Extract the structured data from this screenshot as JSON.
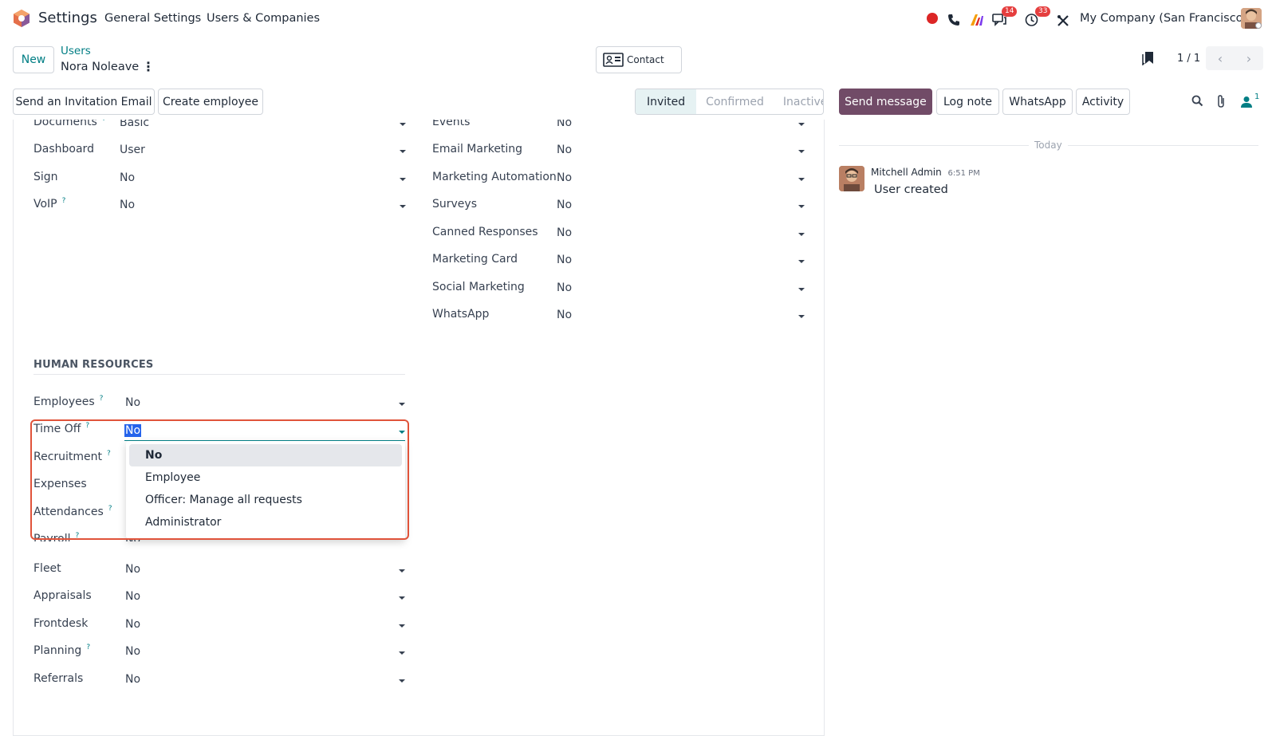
{
  "navbar": {
    "app_name": "Settings",
    "menus": [
      "General Settings",
      "Users & Companies"
    ],
    "messages_badge": "14",
    "activities_badge": "33",
    "company": "My Company (San Francisco)"
  },
  "control_panel": {
    "new_label": "New",
    "breadcrumb_parent": "Users",
    "record_name": "Nora Noleave",
    "contact_label": "Contact",
    "pager": "1 / 1"
  },
  "header_buttons": {
    "invite": "Send an Invitation Email",
    "create_employee": "Create employee"
  },
  "statusbar": [
    "Invited",
    "Confirmed",
    "Inactive"
  ],
  "chatter": {
    "send_message": "Send message",
    "log_note": "Log note",
    "whatsapp": "WhatsApp",
    "activity": "Activity",
    "followers_count": "1",
    "today_label": "Today",
    "message": {
      "author": "Mitchell Admin",
      "time": "6:51 PM",
      "body": "User created"
    }
  },
  "left_fields": [
    {
      "label": "Documents",
      "value": "Basic",
      "help": true
    },
    {
      "label": "Dashboard",
      "value": "User",
      "help": false
    },
    {
      "label": "Sign",
      "value": "No",
      "help": false
    },
    {
      "label": "VoIP",
      "value": "No",
      "help": true
    }
  ],
  "right_fields": [
    {
      "label": "Events",
      "value": "No"
    },
    {
      "label": "Email Marketing",
      "value": "No"
    },
    {
      "label": "Marketing Automation",
      "value": "No"
    },
    {
      "label": "Surveys",
      "value": "No"
    },
    {
      "label": "Canned Responses",
      "value": "No"
    },
    {
      "label": "Marketing Card",
      "value": "No"
    },
    {
      "label": "Social Marketing",
      "value": "No"
    },
    {
      "label": "WhatsApp",
      "value": "No"
    }
  ],
  "hr_section": {
    "title": "HUMAN RESOURCES",
    "fields": [
      {
        "label": "Employees",
        "value": "No",
        "help": true
      },
      {
        "label": "Time Off",
        "value": "No",
        "help": true
      },
      {
        "label": "Recruitment",
        "value": "",
        "help": true
      },
      {
        "label": "Expenses",
        "value": "",
        "help": false
      },
      {
        "label": "Attendances",
        "value": "",
        "help": true
      },
      {
        "label": "Payroll",
        "value": "No",
        "help": true
      },
      {
        "label": "Fleet",
        "value": "No",
        "help": false
      },
      {
        "label": "Appraisals",
        "value": "No",
        "help": false
      },
      {
        "label": "Frontdesk",
        "value": "No",
        "help": false
      },
      {
        "label": "Planning",
        "value": "No",
        "help": true
      },
      {
        "label": "Referrals",
        "value": "No",
        "help": false
      }
    ]
  },
  "timeoff_dropdown": {
    "selected": "No",
    "options": [
      "No",
      "Employee",
      "Officer: Manage all requests",
      "Administrator"
    ]
  },
  "colors": {
    "accent": "#017e84",
    "primary": "#714b67",
    "highlight": "#e0533a"
  }
}
